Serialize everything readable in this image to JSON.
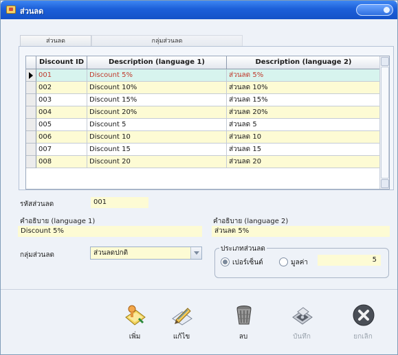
{
  "window": {
    "title": "ส่วนลด"
  },
  "tabs": [
    {
      "label": "ส่วนลด"
    },
    {
      "label": "กลุ่มส่วนลด"
    }
  ],
  "grid": {
    "columns": [
      "Discount ID",
      "Description (language 1)",
      "Description (language 2)"
    ],
    "rows": [
      {
        "id": "001",
        "desc1": "Discount 5%",
        "desc2": "ส่วนลด 5%"
      },
      {
        "id": "002",
        "desc1": "Discount 10%",
        "desc2": "ส่วนลด 10%"
      },
      {
        "id": "003",
        "desc1": "Discount 15%",
        "desc2": "ส่วนลด 15%"
      },
      {
        "id": "004",
        "desc1": "Discount 20%",
        "desc2": "ส่วนลด 20%"
      },
      {
        "id": "005",
        "desc1": "Discount 5",
        "desc2": "ส่วนลด 5"
      },
      {
        "id": "006",
        "desc1": "Discount 10",
        "desc2": "ส่วนลด 10"
      },
      {
        "id": "007",
        "desc1": "Discount 15",
        "desc2": "ส่วนลด 15"
      },
      {
        "id": "008",
        "desc1": "Discount 20",
        "desc2": "ส่วนลด 20"
      }
    ]
  },
  "form": {
    "code_label": "รหัสส่วนลด",
    "code_value": "001",
    "desc1_label": "คำอธิบาย (language 1)",
    "desc1_value": "Discount 5%",
    "desc2_label": "คำอธิบาย (language 2)",
    "desc2_value": "ส่วนลด 5%",
    "group_label": "กลุ่มส่วนลด",
    "group_value": "ส่วนลดปกติ",
    "type_label": "ประเภทส่วนลด",
    "type_percent": "เปอร์เซ็นต์",
    "type_value": "มูลค่า",
    "amount": "5"
  },
  "toolbar": {
    "add": "เพิ่ม",
    "edit": "แก้ไข",
    "delete": "ลบ",
    "save": "บันทึก",
    "cancel": "ยกเลิก"
  }
}
